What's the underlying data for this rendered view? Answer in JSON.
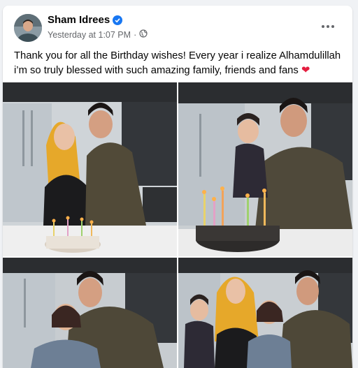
{
  "post": {
    "author_name": "Sham Idrees",
    "timestamp": "Yesterday at 1:07 PM",
    "separator": "·",
    "audience_icon": "globe-icon",
    "verified_icon": "verified-badge-icon",
    "more_icon": "more-options-icon",
    "text_line1": "Thank you for all the Birthday wishes! Every year i realize Alhamdulillah",
    "text_line2": "i’m so truly blessed with such amazing family, friends and fans",
    "emoji": "❤"
  },
  "photos": [
    {
      "description_name": "photo-couple-with-cake"
    },
    {
      "description_name": "photo-man-with-baby-and-cake"
    },
    {
      "description_name": "photo-man-with-girl"
    },
    {
      "description_name": "photo-family-group"
    }
  ],
  "colors": {
    "brand_blue": "#1877f2",
    "text_primary": "#050505",
    "text_secondary": "#65676b",
    "heart_red": "#e41e3f"
  }
}
